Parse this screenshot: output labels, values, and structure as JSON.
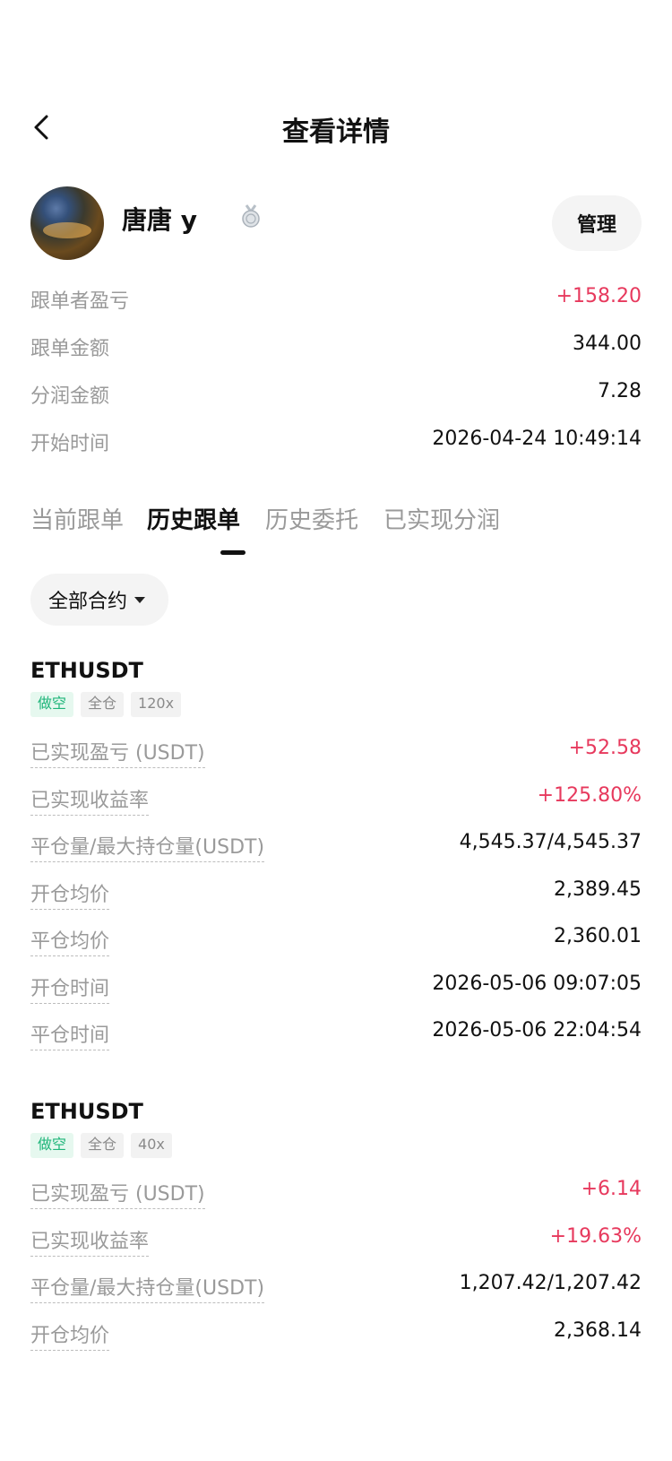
{
  "header": {
    "title": "查看详情"
  },
  "profile": {
    "username": "唐唐 y",
    "manage_label": "管理"
  },
  "summary": [
    {
      "label": "跟单者盈亏",
      "value": "+158.20",
      "positive": true
    },
    {
      "label": "跟单金额",
      "value": "344.00",
      "positive": false
    },
    {
      "label": "分润金额",
      "value": "7.28",
      "positive": false
    },
    {
      "label": "开始时间",
      "value": "2026-04-24 10:49:14",
      "positive": false
    }
  ],
  "tabs": [
    {
      "label": "当前跟单",
      "active": false
    },
    {
      "label": "历史跟单",
      "active": true
    },
    {
      "label": "历史委托",
      "active": false
    },
    {
      "label": "已实现分润",
      "active": false
    }
  ],
  "filter": {
    "label": "全部合约"
  },
  "orders": [
    {
      "symbol": "ETHUSDT",
      "badges": [
        "做空",
        "全仓",
        "120x"
      ],
      "rows": [
        {
          "label": "已实现盈亏 (USDT)",
          "value": "+52.58",
          "positive": true
        },
        {
          "label": "已实现收益率",
          "value": "+125.80%",
          "positive": true
        },
        {
          "label": "平仓量/最大持仓量(USDT)",
          "value": "4,545.37/4,545.37",
          "positive": false
        },
        {
          "label": "开仓均价",
          "value": "2,389.45",
          "positive": false
        },
        {
          "label": "平仓均价",
          "value": "2,360.01",
          "positive": false
        },
        {
          "label": "开仓时间",
          "value": "2026-05-06 09:07:05",
          "positive": false
        },
        {
          "label": "平仓时间",
          "value": "2026-05-06 22:04:54",
          "positive": false
        }
      ]
    },
    {
      "symbol": "ETHUSDT",
      "badges": [
        "做空",
        "全仓",
        "40x"
      ],
      "rows": [
        {
          "label": "已实现盈亏 (USDT)",
          "value": "+6.14",
          "positive": true
        },
        {
          "label": "已实现收益率",
          "value": "+19.63%",
          "positive": true
        },
        {
          "label": "平仓量/最大持仓量(USDT)",
          "value": "1,207.42/1,207.42",
          "positive": false
        },
        {
          "label": "开仓均价",
          "value": "2,368.14",
          "positive": false
        }
      ]
    }
  ],
  "colors": {
    "positive": "#e7395d",
    "short_badge": "#1fb57a",
    "muted": "#9a9a9a"
  }
}
